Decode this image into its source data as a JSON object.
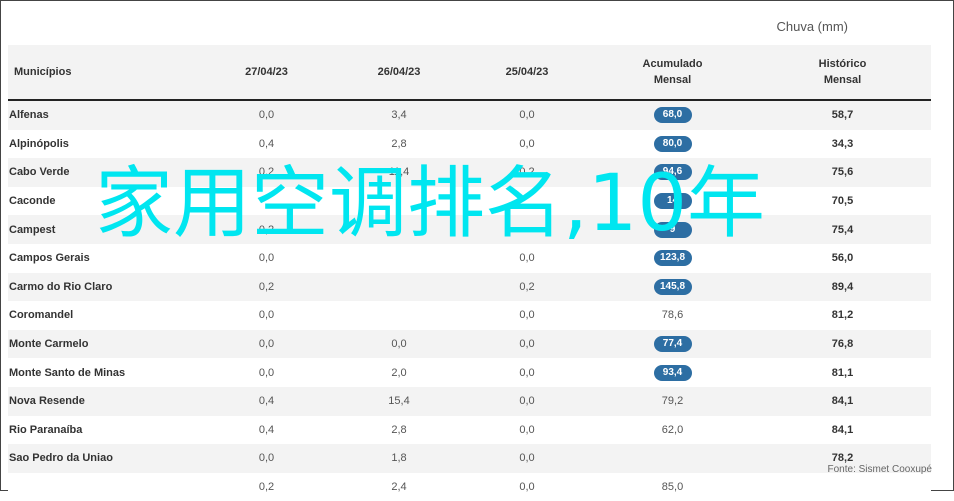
{
  "header": {
    "unit": "Chuva (mm)",
    "col_city": "Municípios",
    "col_d1": "27/04/23",
    "col_d2": "26/04/23",
    "col_d3": "25/04/23",
    "col_acc": "Acumulado\nMensal",
    "col_hist": "Histórico\nMensal"
  },
  "colors": {
    "pill": "#2d6ea3",
    "overlay": "#00e6f0"
  },
  "rows": [
    {
      "name": "Alfenas",
      "d1": "0,0",
      "d2": "3,4",
      "d3": "0,0",
      "acc": "68,0",
      "acc_badge": true,
      "hist": "58,7"
    },
    {
      "name": "Alpinópolis",
      "d1": "0,4",
      "d2": "2,8",
      "d3": "0,0",
      "acc": "80,0",
      "acc_badge": true,
      "hist": "34,3"
    },
    {
      "name": "Cabo Verde",
      "d1": "0,2",
      "d2": "11,4",
      "d3": "0,2",
      "acc": "94,6",
      "acc_badge": true,
      "hist": "75,6"
    },
    {
      "name": "Caconde",
      "d1": "",
      "d2": "",
      "d3": "",
      "acc": "14",
      "acc_badge": true,
      "hist": "70,5"
    },
    {
      "name": "Campest",
      "d1": "0,2",
      "d2": "",
      "d3": "",
      "acc": "9",
      "acc_badge": true,
      "hist": "75,4"
    },
    {
      "name": "Campos Gerais",
      "d1": "0,0",
      "d2": "",
      "d3": "0,0",
      "acc": "123,8",
      "acc_badge": true,
      "hist": "56,0"
    },
    {
      "name": "Carmo do Rio Claro",
      "d1": "0,2",
      "d2": "",
      "d3": "0,2",
      "acc": "145,8",
      "acc_badge": true,
      "hist": "89,4"
    },
    {
      "name": "Coromandel",
      "d1": "0,0",
      "d2": "",
      "d3": "0,0",
      "acc": "78,6",
      "acc_badge": false,
      "hist": "81,2"
    },
    {
      "name": "Monte Carmelo",
      "d1": "0,0",
      "d2": "0,0",
      "d3": "0,0",
      "acc": "77,4",
      "acc_badge": true,
      "hist": "76,8"
    },
    {
      "name": "Monte Santo de Minas",
      "d1": "0,0",
      "d2": "2,0",
      "d3": "0,0",
      "acc": "93,4",
      "acc_badge": true,
      "hist": "81,1"
    },
    {
      "name": "Nova Resende",
      "d1": "0,4",
      "d2": "15,4",
      "d3": "0,0",
      "acc": "79,2",
      "acc_badge": false,
      "hist": "84,1"
    },
    {
      "name": "Rio Paranaíba",
      "d1": "0,4",
      "d2": "2,8",
      "d3": "0,0",
      "acc": "62,0",
      "acc_badge": false,
      "hist": "84,1"
    },
    {
      "name": "Sao Pedro da Uniao",
      "d1": "0,0",
      "d2": "1,8",
      "d3": "0,0",
      "acc": "",
      "acc_badge": false,
      "hist": "78,2"
    },
    {
      "name": "",
      "d1": "0,2",
      "d2": "2,4",
      "d3": "0,0",
      "acc": "85,0",
      "acc_badge": false,
      "hist": ""
    }
  ],
  "source": "Fonte: Sismet Cooxupé",
  "overlay": "家用空调排名,10年"
}
